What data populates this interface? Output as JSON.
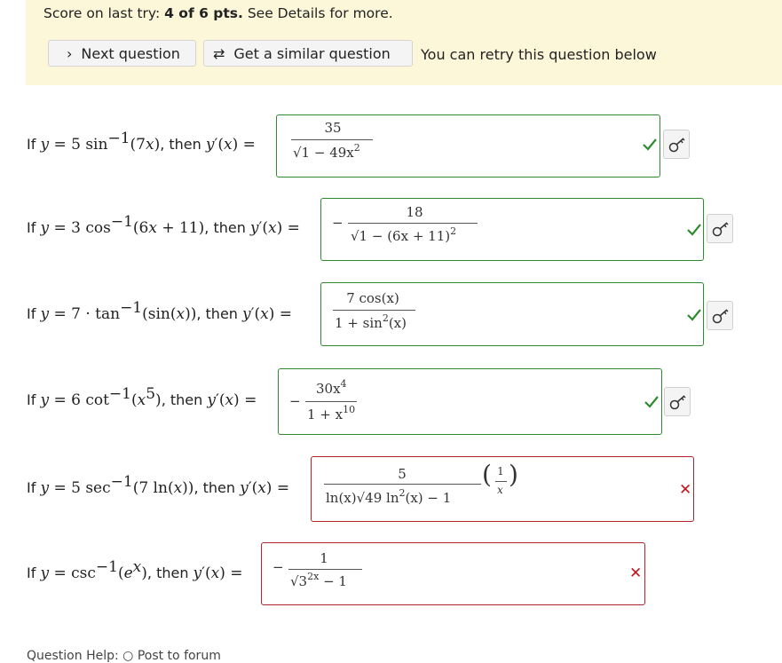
{
  "header": {
    "score_prefix": "Score on last try:",
    "score_value": "4 of 6 pts.",
    "score_suffix": "See Details for more.",
    "next_label": "Next question",
    "similar_label": "Get a similar question",
    "retry_text": "You can retry this question below"
  },
  "questions": [
    {
      "prefix": "If",
      "fn": "y = 5 sin",
      "arg": "(7x), then",
      "deriv": "y′(x) =",
      "num": "35",
      "den": "√1 − 49x",
      "status": "correct"
    },
    {
      "prefix": "If",
      "fn": "y = 3 cos",
      "arg": "(6x + 11), then",
      "deriv": "y′(x) =",
      "num": "18",
      "den": "√1 − (6x + 11)",
      "status": "correct"
    },
    {
      "prefix": "If",
      "fn": "y = 7 · tan",
      "arg": "(sin(x)), then",
      "deriv": "y′(x) =",
      "num": "7 cos(x)",
      "den": "1 + sin",
      "den_tail": "(x)",
      "status": "correct"
    },
    {
      "prefix": "If",
      "fn": "y = 6 cot",
      "arg": "(x",
      "arg_tail": "), then",
      "deriv": "y′(x) =",
      "num": "30x",
      "den": "1 + x",
      "status": "correct"
    },
    {
      "prefix": "If",
      "fn": "y = 5 sec",
      "arg": "(7 ln(x)), then",
      "deriv": "y′(x) =",
      "num": "5",
      "den": "ln(x)√49 ln",
      "den_tail": "(x) − 1",
      "status": "incorrect"
    },
    {
      "prefix": "If",
      "fn": "y = csc",
      "arg": "(e",
      "arg_tail": "), then",
      "deriv": "y′(x) =",
      "num": "1",
      "den": "√3",
      "den_tail": " − 1",
      "status": "incorrect"
    }
  ],
  "footer": {
    "partial": "Question Help:  ○ Post to forum"
  },
  "colors": {
    "correct": "#2e8b2e",
    "incorrect": "#b0242b",
    "banner": "#fcf7d9"
  },
  "icons": {
    "check": "check-icon",
    "cross": "cross-icon",
    "key": "key-icon"
  }
}
